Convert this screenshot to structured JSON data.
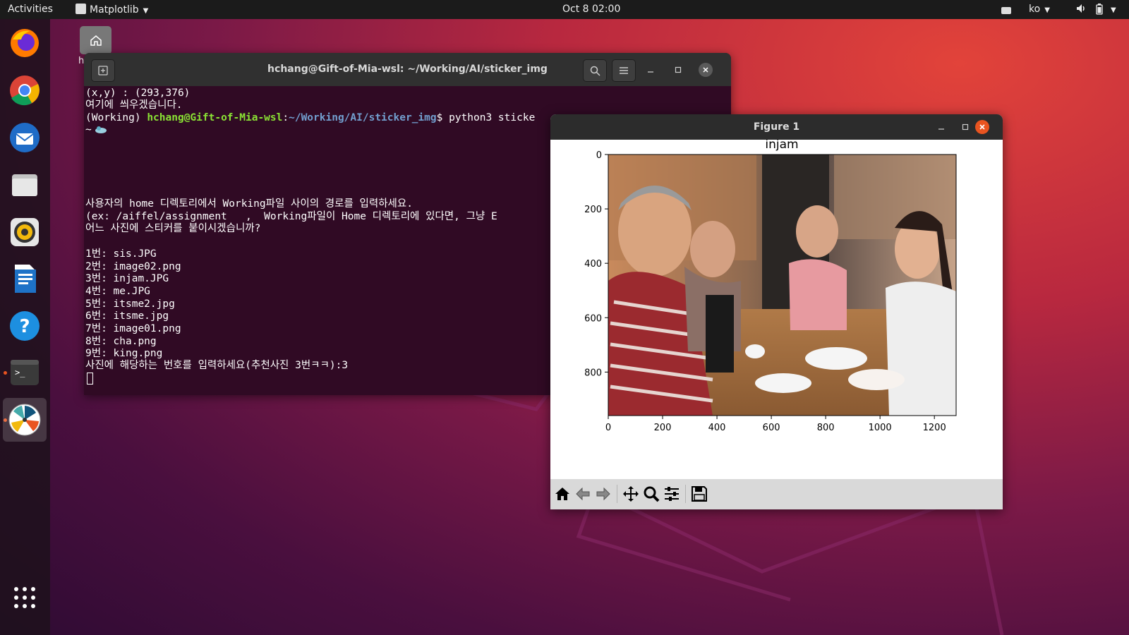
{
  "topbar": {
    "activities": "Activities",
    "app_menu": "Matplotlib",
    "clock": "Oct 8  02:00",
    "input_method": "ko"
  },
  "desktop": {
    "home_label": "h"
  },
  "terminal": {
    "title": "hchang@Gift-of-Mia-wsl: ~/Working/AI/sticker_img",
    "lines": {
      "l0": "(x,y) : (293,376)",
      "l1": "여기에 씌우겠습니다.",
      "l2_env": "(Working) ",
      "l2_user": "hchang@Gift-of-Mia-wsl",
      "l2_colon": ":",
      "l2_path": "~/Working/AI/sticker_img",
      "l2_cmd": "$ python3 sticke",
      "l3": "~",
      "l4": "사용자의 home 디렉토리에서 Working파일 사이의 경로를 입력하세요.",
      "l5": "(ex: /aiffel/assignment   ,  Working파일이 Home 디렉토리에 있다면, 그냥 E",
      "l6": "어느 사진에 스티커를 붙이시겠습니까?",
      "files": [
        "1번: sis.JPG",
        "2번: image02.png",
        "3번: injam.JPG",
        "4번: me.JPG",
        "5번: itsme2.jpg",
        "6번: itsme.jpg",
        "7번: image01.png",
        "8번: cha.png",
        "9번: king.png"
      ],
      "prompt": "사진에 해당하는 번호를 입력하세요(추천사진 3번ㅋㅋ):3"
    }
  },
  "figure": {
    "title": "Figure 1"
  },
  "chart_data": {
    "type": "image",
    "title": "injam",
    "xlim": [
      0,
      1280
    ],
    "ylim": [
      960,
      0
    ],
    "xticks": [
      "0",
      "200",
      "400",
      "600",
      "800",
      "1000",
      "1200"
    ],
    "yticks": [
      "0",
      "200",
      "400",
      "600",
      "800"
    ],
    "xtick_values": [
      0,
      200,
      400,
      600,
      800,
      1000,
      1200
    ],
    "ytick_values": [
      0,
      200,
      400,
      600,
      800
    ]
  },
  "colors": {
    "terminal_bg": "#300a24",
    "prompt_user": "#8ae234",
    "prompt_path": "#729fcf",
    "accent": "#e95420"
  }
}
